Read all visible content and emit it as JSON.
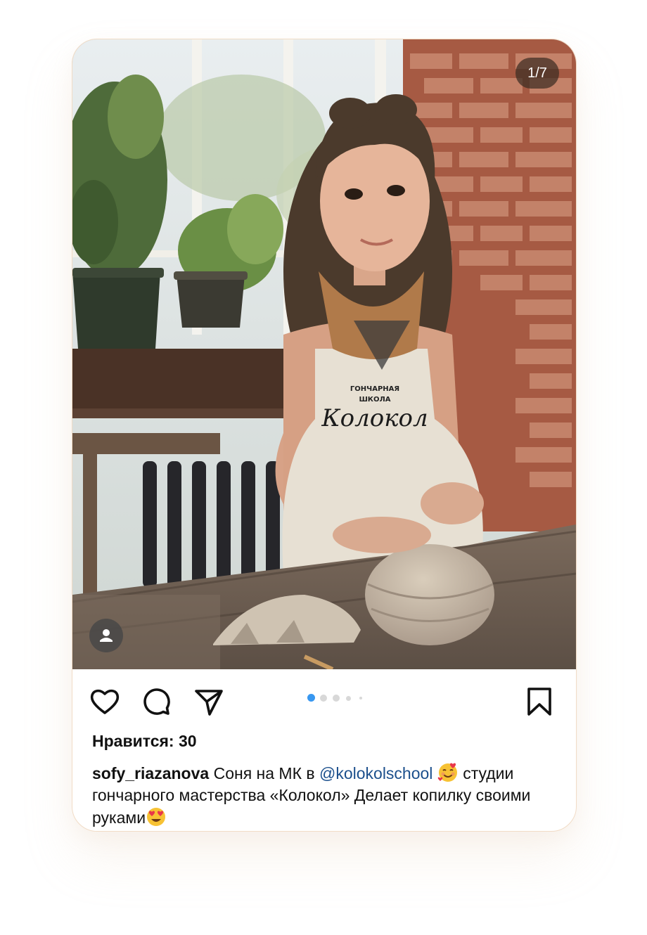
{
  "photo": {
    "counter": "1/7",
    "apron_line1": "ГОНЧАРНАЯ",
    "apron_line2": "ШКОЛА",
    "apron_script": "Колокол",
    "slide_index": 1,
    "slide_total": 7
  },
  "actions": {
    "like_icon": "heart-icon",
    "comment_icon": "comment-icon",
    "share_icon": "send-icon",
    "save_icon": "bookmark-icon",
    "active_dot_color": "#3897f0",
    "inactive_dot_color": "#d8d8d8"
  },
  "post": {
    "likes": "Нравится: 30",
    "author": "sofy_riazanova",
    "caption_part1": " Соня на МК в ",
    "mention": "@kolokolschool",
    "caption_part2": " студии гончарного мастерства «Колокол»  Делает копилку своими руками",
    "emoji1": "smiling-face-with-hearts",
    "emoji2": "heart-eyes"
  }
}
